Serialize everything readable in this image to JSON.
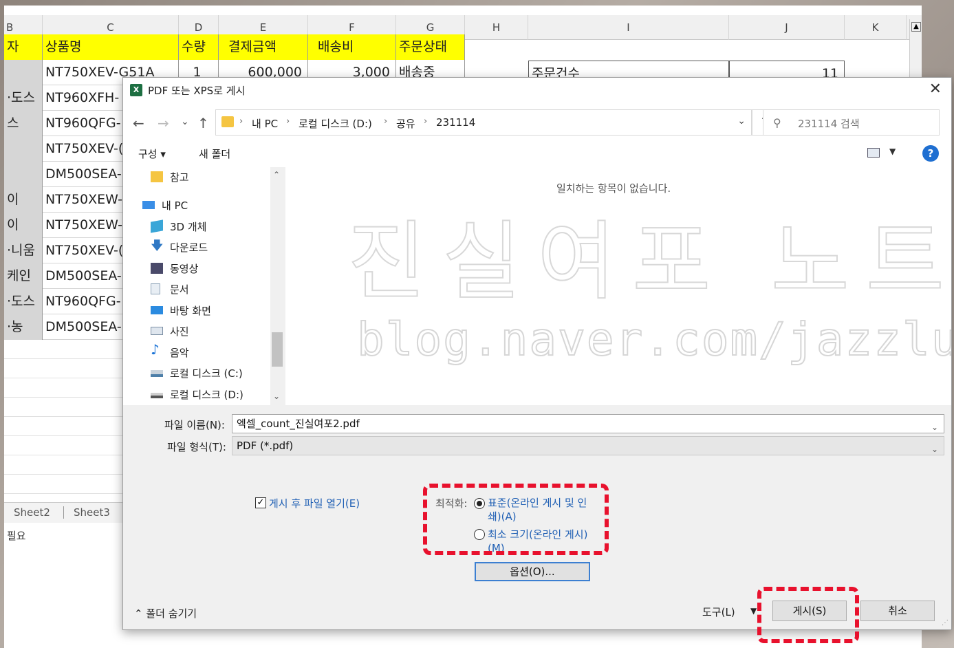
{
  "spreadsheet": {
    "columns": [
      "B",
      "C",
      "D",
      "E",
      "F",
      "G",
      "H",
      "I",
      "J",
      "K"
    ],
    "headers": [
      "자",
      "상품명",
      "수량",
      "결제금액",
      "배송비",
      "주문상태"
    ],
    "rows": [
      [
        "",
        "NT750XEV-G51A",
        "1",
        "600,000",
        "3,000",
        "배송중"
      ],
      [
        "·도스",
        "NT960XFH-",
        "",
        "",
        "",
        ""
      ],
      [
        "스",
        "NT960QFG-",
        "",
        "",
        "",
        ""
      ],
      [
        "",
        "NT750XEV-(",
        "",
        "",
        "",
        ""
      ],
      [
        "",
        "DM500SEA-",
        "",
        "",
        "",
        ""
      ],
      [
        "이",
        "NT750XEW-",
        "",
        "",
        "",
        ""
      ],
      [
        "이",
        "NT750XEW-",
        "",
        "",
        "",
        ""
      ],
      [
        "·니움",
        "NT750XEV-(",
        "",
        "",
        "",
        ""
      ],
      [
        "케인",
        "DM500SEA-",
        "",
        "",
        "",
        ""
      ],
      [
        "·도스",
        "NT960QFG-",
        "",
        "",
        "",
        ""
      ],
      [
        "·농",
        "DM500SEA-",
        "",
        "",
        "",
        ""
      ]
    ],
    "side_label": "주문건수",
    "side_value": "11",
    "sheet_tabs": [
      "Sheet2",
      "Sheet3"
    ],
    "status_text": "필요",
    "scroll_up": "▲"
  },
  "dialog": {
    "icon": "X",
    "title": "PDF 또는 XPS로 게시",
    "close": "✕",
    "nav": {
      "back": "←",
      "forward": "→",
      "recent": "⌄",
      "up": "↑",
      "refresh": "↻",
      "address_dropdown": "⌄",
      "breadcrumbs": [
        "내 PC",
        "로컬 디스크 (D:)",
        "공유",
        "231114"
      ],
      "separator": "›",
      "search_placeholder": "231114 검색",
      "search_icon": "⚲"
    },
    "commands": {
      "organize": "구성 ▾",
      "new_folder": "새 폴더",
      "view_dropdown": "▼",
      "help": "?"
    },
    "nav_pane": {
      "items": [
        {
          "label": "참고",
          "icon": "folder-icon",
          "color": "#f5c542"
        },
        {
          "label": "내 PC",
          "icon": "pc-icon",
          "color": "#3a8ee6"
        },
        {
          "label": "3D 개체",
          "icon": "cube-icon",
          "color": "#3aa6d8"
        },
        {
          "label": "다운로드",
          "icon": "download-icon",
          "color": "#2f78c4"
        },
        {
          "label": "동영상",
          "icon": "video-icon",
          "color": "#4a4a6a"
        },
        {
          "label": "문서",
          "icon": "document-icon",
          "color": "#8ea3b8"
        },
        {
          "label": "바탕 화면",
          "icon": "desktop-icon",
          "color": "#2b8be0"
        },
        {
          "label": "사진",
          "icon": "pictures-icon",
          "color": "#7c8fa4"
        },
        {
          "label": "음악",
          "icon": "music-icon",
          "color": "#1c74d6"
        },
        {
          "label": "로컬 디스크 (C:)",
          "icon": "drive-c-icon",
          "color": "#4d7fa8"
        },
        {
          "label": "로컬 디스크 (D:)",
          "icon": "drive-d-icon",
          "color": "#555555"
        }
      ],
      "scroll_up": "⌃",
      "scroll_down": "⌄"
    },
    "content": {
      "empty_message": "일치하는 항목이 없습니다.",
      "watermark_title": "진실여포 노트북",
      "watermark_url": "blog.naver.com/jazzlub"
    },
    "filename_label": "파일 이름(N):",
    "filename_value": "엑셀_count_진실여포2.pdf",
    "filetype_label": "파일 형식(T):",
    "filetype_value": "PDF (*.pdf)",
    "dropdown_arrow": "⌄",
    "open_after_check": "✓",
    "open_after_label": "게시 후 파일 열기(E)",
    "optimize_label": "최적화:",
    "optimize_options": [
      "표준(온라인 게시 및 인쇄)(A)",
      "최소 크기(온라인 게시)(M)"
    ],
    "options_button": "옵션(O)...",
    "hide_folders": "⌃ 폴더 숨기기",
    "tools_label": "도구(L)",
    "tools_dropdown": "▼",
    "publish_button": "게시(S)",
    "cancel_button": "취소",
    "grip": "⋰"
  },
  "colors": {
    "header_yellow": "#ffff00",
    "highlight_red": "#e8112d",
    "link_blue": "#1f5fb4",
    "excel_green": "#1d6f42"
  }
}
